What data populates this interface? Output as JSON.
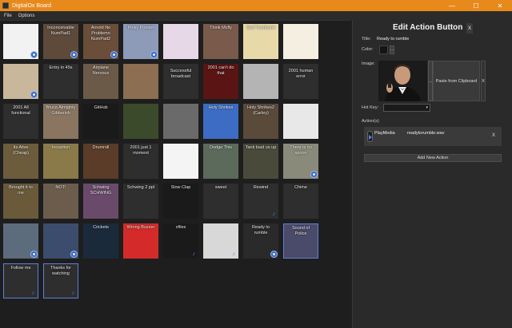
{
  "window": {
    "title": "DigitalOx Board",
    "controls": {
      "minimize": "—",
      "maximize": "☐",
      "close": "✕"
    }
  },
  "menu": {
    "file": "File",
    "options": "Options"
  },
  "board": {
    "tiles": [
      {
        "row": 0,
        "col": 0,
        "label": "",
        "bg": "#f2f2f2",
        "icon": "gear"
      },
      {
        "row": 0,
        "col": 1,
        "label": "Inconceivable\nNumPad1",
        "bg": "#5d4a3a",
        "icon": "gear"
      },
      {
        "row": 0,
        "col": 2,
        "label": "Arnold No\nProblemo\nNumPad2",
        "bg": "#6a4e3a",
        "icon": "gear"
      },
      {
        "row": 0,
        "col": 3,
        "label": "Pinky Ponder",
        "bg": "#8d9bb8",
        "icon": "gear"
      },
      {
        "row": 0,
        "col": 4,
        "label": "",
        "bg": "#e6d8e6",
        "icon": ""
      },
      {
        "row": 0,
        "col": 5,
        "label": "Think Mcfly",
        "bg": "#7a5a4a",
        "icon": ""
      },
      {
        "row": 0,
        "col": 6,
        "label": "Sad Trombone",
        "bg": "#e8d9a8",
        "icon": ""
      },
      {
        "row": 0,
        "col": 7,
        "label": "",
        "bg": "#f4efe0",
        "icon": ""
      },
      {
        "row": 1,
        "col": 0,
        "label": "",
        "bg": "#c9b79b",
        "icon": "gear"
      },
      {
        "row": 1,
        "col": 1,
        "label": "Entry in 45s",
        "bg": "#2e2e2e",
        "icon": ""
      },
      {
        "row": 1,
        "col": 2,
        "label": "Airplane\nNervous",
        "bg": "#6b5a48",
        "icon": ""
      },
      {
        "row": 1,
        "col": 3,
        "label": "",
        "bg": "#8c6e52",
        "icon": ""
      },
      {
        "row": 1,
        "col": 4,
        "label": "Successful\nbroadcast",
        "bg": "#2e2e2e",
        "icon": "",
        "mid": true
      },
      {
        "row": 1,
        "col": 5,
        "label": "2001 can't do\nthat",
        "bg": "#5a1414",
        "icon": ""
      },
      {
        "row": 1,
        "col": 6,
        "label": "",
        "bg": "#b4b4b4",
        "icon": ""
      },
      {
        "row": 1,
        "col": 7,
        "label": "2001 human\nerror",
        "bg": "#2e2e2e",
        "icon": "",
        "mid": true
      },
      {
        "row": 2,
        "col": 0,
        "label": "2001 All\nfunctional",
        "bg": "#2e2e2e",
        "icon": ""
      },
      {
        "row": 2,
        "col": 1,
        "label": "Bruce Almighty\nGibberish",
        "bg": "#8a7560",
        "icon": ""
      },
      {
        "row": 2,
        "col": 2,
        "label": "GitHub",
        "bg": "#1a1a1a",
        "icon": ""
      },
      {
        "row": 2,
        "col": 3,
        "label": "",
        "bg": "#3c4a2c",
        "icon": ""
      },
      {
        "row": 2,
        "col": 4,
        "label": "",
        "bg": "#6a6a6a",
        "icon": ""
      },
      {
        "row": 2,
        "col": 5,
        "label": "Holy Shrikes",
        "bg": "#3c6cc4",
        "icon": ""
      },
      {
        "row": 2,
        "col": 6,
        "label": "Holy Shrikes2\n(Carley)",
        "bg": "#5a4a3a",
        "icon": ""
      },
      {
        "row": 2,
        "col": 7,
        "label": "",
        "bg": "#e8e8e8",
        "icon": ""
      },
      {
        "row": 3,
        "col": 0,
        "label": "Its Alive\n(Cheap)",
        "bg": "#6c5c3c",
        "icon": ""
      },
      {
        "row": 3,
        "col": 1,
        "label": "Inception",
        "bg": "#8a7a4a",
        "icon": ""
      },
      {
        "row": 3,
        "col": 2,
        "label": "Drumroll",
        "bg": "#5a3c28",
        "icon": ""
      },
      {
        "row": 3,
        "col": 3,
        "label": "2001 just 1\nmoment",
        "bg": "#2e2e2e",
        "icon": ""
      },
      {
        "row": 3,
        "col": 4,
        "label": "",
        "bg": "#f4f4f4",
        "icon": ""
      },
      {
        "row": 3,
        "col": 5,
        "label": "Dodge This",
        "bg": "#5c6a5c",
        "icon": ""
      },
      {
        "row": 3,
        "col": 6,
        "label": "Tank load us up",
        "bg": "#4a4a3a",
        "icon": ""
      },
      {
        "row": 3,
        "col": 7,
        "label": "There is no\nspoon",
        "bg": "#8a8a7a",
        "icon": "gear"
      },
      {
        "row": 4,
        "col": 0,
        "label": "Brought it to\nme",
        "bg": "#6a5a3a",
        "icon": ""
      },
      {
        "row": 4,
        "col": 1,
        "label": "NOT!",
        "bg": "#6c5c4c",
        "icon": ""
      },
      {
        "row": 4,
        "col": 2,
        "label": "Schwing\nSCHWING",
        "bg": "#6a4a6a",
        "icon": ""
      },
      {
        "row": 4,
        "col": 3,
        "label": "Schwing 2 ppl",
        "bg": "#2e2e2e",
        "icon": ""
      },
      {
        "row": 4,
        "col": 4,
        "label": "Slow Clap",
        "bg": "#1a1a1a",
        "icon": ""
      },
      {
        "row": 4,
        "col": 5,
        "label": "sweet",
        "bg": "#2e2e2e",
        "icon": ""
      },
      {
        "row": 4,
        "col": 6,
        "label": "Rewind",
        "bg": "#2e2e2e",
        "icon": "sound"
      },
      {
        "row": 4,
        "col": 7,
        "label": "Chime",
        "bg": "#2e2e2e",
        "icon": ""
      },
      {
        "row": 5,
        "col": 0,
        "label": "",
        "bg": "#5c6c7c",
        "icon": "gear"
      },
      {
        "row": 5,
        "col": 1,
        "label": "",
        "bg": "#3c4c6c",
        "icon": "gear"
      },
      {
        "row": 5,
        "col": 2,
        "label": "Crickets",
        "bg": "#1a2a3a",
        "icon": ""
      },
      {
        "row": 5,
        "col": 3,
        "label": "Wrong Buzzer",
        "bg": "#d42a2a",
        "icon": ""
      },
      {
        "row": 5,
        "col": 4,
        "label": "xfiles",
        "bg": "#1a1a1a",
        "icon": "sound"
      },
      {
        "row": 5,
        "col": 5,
        "label": "",
        "bg": "#d8d8d8",
        "icon": "sound"
      },
      {
        "row": 5,
        "col": 6,
        "label": "Ready to\nrumble",
        "bg": "#2a2a2a",
        "icon": "gear"
      },
      {
        "row": 5,
        "col": 7,
        "label": "Sound of Police",
        "bg": "#4a4a6a",
        "icon": "",
        "selected": true
      },
      {
        "row": 6,
        "col": 0,
        "label": "Follow me",
        "bg": "#2e2e2e",
        "icon": "sound",
        "selected": true
      },
      {
        "row": 6,
        "col": 1,
        "label": "Thanks for\nwatching",
        "bg": "#2e2e2e",
        "icon": "sound",
        "selected": true
      }
    ]
  },
  "panel": {
    "title": "Edit Action Button",
    "close": "X",
    "title_label": "Title:",
    "title_value": "Ready to rumble",
    "color_label": "Color:",
    "color_dots": "...",
    "image_label": "Image:",
    "image_dots": "...",
    "paste_label": "Paste from Clipboard",
    "image_x": "X",
    "hotkey_label": "Hot Key:",
    "actions_label": "Action(s)",
    "action": {
      "type": "PlayMedia",
      "file": "readytorumble.wav",
      "remove": "X"
    },
    "add_action": "Add New Action"
  }
}
